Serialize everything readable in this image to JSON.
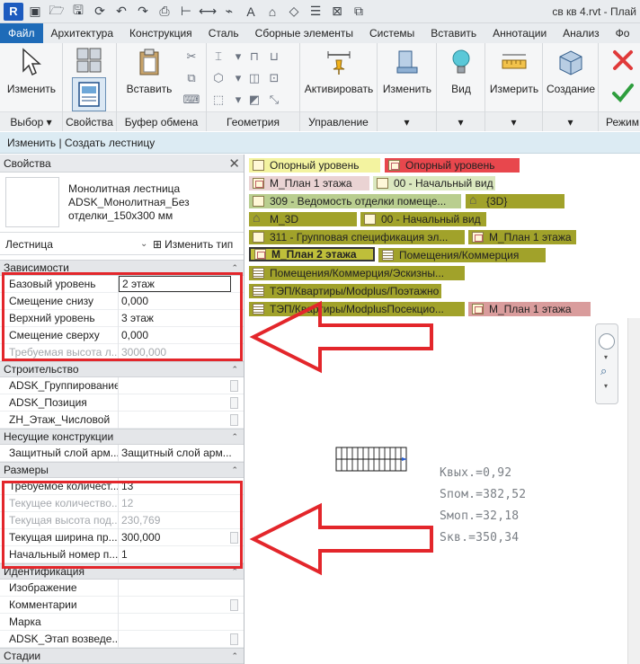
{
  "app": {
    "logo_letter": "R",
    "window_title": "св кв 4.rvt - Плай"
  },
  "ribbon_tabs": [
    "Файл",
    "Архитектура",
    "Конструкция",
    "Сталь",
    "Сборные элементы",
    "Системы",
    "Вставить",
    "Аннотации",
    "Анализ",
    "Фо"
  ],
  "ribbon": {
    "buttons": {
      "modify": "Изменить",
      "insert": "Вставить",
      "activate": "Активировать",
      "modify2": "Изменить",
      "view": "Вид",
      "measure": "Измерить",
      "create": "Создание"
    },
    "panels": {
      "select": "Выбор ▾",
      "properties": "Свойства",
      "clipboard": "Буфер обмена",
      "geometry": "Геометрия",
      "control": "Управление",
      "mode": "Режим"
    },
    "colors": {
      "cancel": "#e03a3a",
      "finish": "#2e9e3e",
      "active_tab": "#1e6bb8"
    }
  },
  "context_bar": "Изменить | Создать лестницу",
  "properties": {
    "title": "Свойства",
    "type_name": "Монолитная лестница ADSK_Монолитная_Без отделки_150x300 мм",
    "type_filter": "Лестница",
    "edit_type": "Изменить тип",
    "groups": [
      {
        "name": "Зависимости",
        "rows": [
          {
            "key": "Базовый уровень",
            "value": "2 этаж"
          },
          {
            "key": "Смещение снизу",
            "value": "0,000"
          },
          {
            "key": "Верхний уровень",
            "value": "3 этаж"
          },
          {
            "key": "Смещение сверху",
            "value": "0,000"
          },
          {
            "key": "Требуемая высота л...",
            "value": "3000,000"
          }
        ]
      },
      {
        "name": "Строительство",
        "rows": [
          {
            "key": "ADSK_Группирование",
            "value": ""
          },
          {
            "key": "ADSK_Позиция",
            "value": ""
          },
          {
            "key": "ZH_Этаж_Числовой",
            "value": ""
          }
        ]
      },
      {
        "name": "Несущие конструкции",
        "rows": [
          {
            "key": "Защитный слой арм...",
            "value": "Защитный слой арм..."
          }
        ]
      },
      {
        "name": "Размеры",
        "rows": [
          {
            "key": "Требуемое количест...",
            "value": "13"
          },
          {
            "key": "Текущее количество...",
            "value": "12"
          },
          {
            "key": "Текущая высота под...",
            "value": "230,769"
          },
          {
            "key": "Текущая ширина пр...",
            "value": "300,000"
          },
          {
            "key": "Начальный номер п...",
            "value": "1"
          }
        ]
      },
      {
        "name": "Идентификация",
        "rows": [
          {
            "key": "Изображение",
            "value": ""
          },
          {
            "key": "Комментарии",
            "value": ""
          },
          {
            "key": "Марка",
            "value": ""
          },
          {
            "key": "ADSK_Этап возведе...",
            "value": ""
          }
        ]
      },
      {
        "name": "Стадии",
        "rows": []
      }
    ]
  },
  "view_tabs": [
    "Опорный уровень",
    "Опорный уровень",
    "М_План 1 этажа",
    "00 - Начальный вид",
    "309 - Ведомость отделки помеще...",
    "{3D}",
    "М_3D",
    "00 - Начальный вид",
    "311 - Групповая спецификация эл...",
    "М_План 1 этажа",
    "М_План 2 этажа",
    "Помещения/Коммерция",
    "Помещения/Коммерция/Эскизны...",
    "ТЭП/Квартиры/Modplus/Поэтажно",
    "ТЭП/Квартиры/ModplusПосекцио...",
    "М_План 1 этажа"
  ],
  "annotations": [
    "Kвых.=0,92",
    "Sпом.=382,52",
    "Sмоп.=32,18",
    "Sкв.=350,34"
  ],
  "highlight_color": "#e3262b"
}
